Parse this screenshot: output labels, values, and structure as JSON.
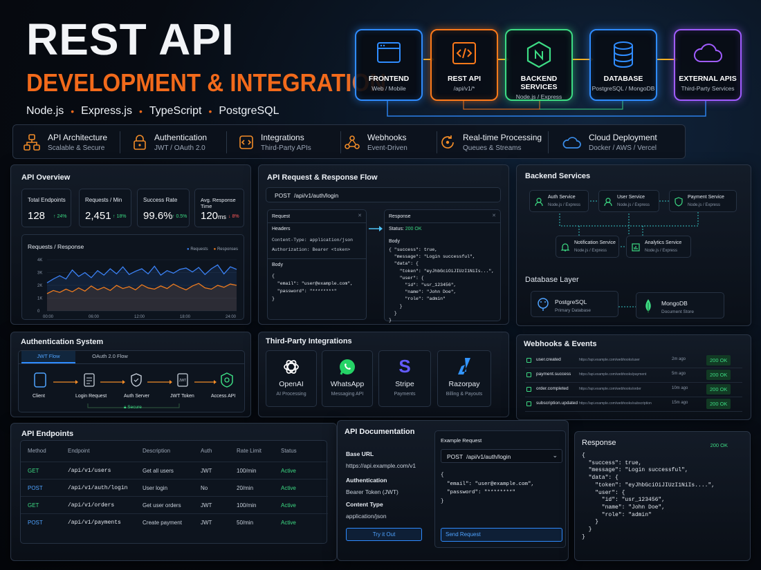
{
  "header": {
    "title_line1": "REST API",
    "title_line2": "DEVELOPMENT & INTEGRATION",
    "tech_stack": [
      "Node.js",
      "Express.js",
      "TypeScript",
      "PostgreSQL"
    ],
    "separator": "•"
  },
  "flow": [
    {
      "title": "FRONTEND",
      "sub": "Web / Mobile",
      "icon": "browser-window-icon",
      "color": "#2f8cff"
    },
    {
      "title": "REST API",
      "sub": "/api/v1/*",
      "icon": "code-icon",
      "color": "#ff7a1a"
    },
    {
      "title": "BACKEND SERVICES",
      "sub": "Node.js / Express",
      "icon": "nodejs-hexagon-icon",
      "color": "#3ddc84"
    },
    {
      "title": "DATABASE",
      "sub": "PostgreSQL / MongoDB",
      "icon": "database-icon",
      "color": "#2f8cff"
    },
    {
      "title": "EXTERNAL APIS",
      "sub": "Third-Party Services",
      "icon": "cloud-icon",
      "color": "#a05cff"
    }
  ],
  "features": [
    {
      "title": "API Architecture",
      "sub": "Scalable & Secure",
      "icon": "architecture-icon"
    },
    {
      "title": "Authentication",
      "sub": "JWT / OAuth 2.0",
      "icon": "lock-icon"
    },
    {
      "title": "Integrations",
      "sub": "Third-Party APIs",
      "icon": "integration-icon"
    },
    {
      "title": "Webhooks",
      "sub": "Event-Driven",
      "icon": "webhook-icon"
    },
    {
      "title": "Real-time Processing",
      "sub": "Queues & Streams",
      "icon": "refresh-icon"
    },
    {
      "title": "Cloud Deployment",
      "sub": "Docker / AWS / Vercel",
      "icon": "cloud-icon"
    }
  ],
  "overview": {
    "title": "API Overview",
    "stats": [
      {
        "label": "Total Endpoints",
        "value": "128",
        "delta": "↑ 24%",
        "up": true
      },
      {
        "label": "Requests / Min",
        "value": "2,451",
        "delta": "↑ 18%",
        "up": true
      },
      {
        "label": "Success Rate",
        "value": "99.6%",
        "delta": "↑ 0.5%",
        "up": true
      },
      {
        "label": "Avg. Response Time",
        "value": "120",
        "unit": "ms",
        "delta": "↓ 8%",
        "up": false
      }
    ],
    "chart_title": "Requests / Response"
  },
  "chart_data": {
    "type": "line",
    "title": "Requests / Response",
    "x": [
      "00:00",
      "06:00",
      "12:00",
      "18:00",
      "24:00"
    ],
    "yticks": [
      "4K",
      "3K",
      "2K",
      "1K",
      "0"
    ],
    "ylim": [
      0,
      4000
    ],
    "legend_position": "top-right",
    "series": [
      {
        "name": "Requests",
        "color": "#3b82f6",
        "values": [
          2200,
          2500,
          2750,
          2500,
          3200,
          2700,
          3000,
          2600,
          3150,
          2800,
          3300,
          2900,
          3450,
          2850,
          3100,
          3300,
          2900,
          3500,
          2800,
          3150,
          2950,
          3250,
          3350,
          3050,
          3400,
          2850,
          3300,
          3600,
          2900,
          3450,
          3250
        ]
      },
      {
        "name": "Responses",
        "color": "#f07c1e",
        "values": [
          1350,
          1600,
          1450,
          1700,
          1500,
          1800,
          1550,
          1950,
          1650,
          1850,
          1600,
          2000,
          1750,
          1900,
          1650,
          2050,
          1800,
          1700,
          1950,
          1750,
          2100,
          1850,
          1650,
          1950,
          2150,
          1800,
          1700,
          2000,
          1850,
          2100,
          2000
        ]
      }
    ]
  },
  "flowpanel": {
    "title": "API Request & Response Flow",
    "method": "POST",
    "path": "/api/v1/auth/login",
    "request_title": "Request",
    "headers_label": "Headers",
    "header_lines": [
      "Content-Type: application/json",
      "Authorization: Bearer <token>"
    ],
    "body_label": "Body",
    "body_code": "{\n  \"email\": \"user@example.com\",\n  \"password\": \"********\"\n}",
    "response_title": "Response",
    "status_label": "Status:",
    "status_value": "200 OK",
    "resp_body_label": "Body",
    "resp_code": "{ \"success\": true,\n  \"message\": \"Login successful\",\n  \"data\": {\n    \"token\": \"eyJhbGciOiJIUzI1NiIs...\",\n    \"user\": {\n      \"id\": \"usr_123456\",\n      \"name\": \"John Doe\",\n      \"role\": \"admin\"\n    }\n  }\n}"
  },
  "backend": {
    "title": "Backend Services",
    "services": [
      {
        "name": "Auth Service",
        "sub": "Node.js / Express",
        "icon": "user-icon"
      },
      {
        "name": "User Service",
        "sub": "Node.js / Express",
        "icon": "user-icon"
      },
      {
        "name": "Payment Service",
        "sub": "Node.js / Express",
        "icon": "shield-icon"
      },
      {
        "name": "Notification Service",
        "sub": "Node.js / Express",
        "icon": "bell-icon"
      },
      {
        "name": "Analytics Service",
        "sub": "Node.js / Express",
        "icon": "chart-icon"
      }
    ],
    "db_title": "Database Layer",
    "dbs": [
      {
        "name": "PostgreSQL",
        "sub": "Primary Database",
        "icon": "postgresql-icon"
      },
      {
        "name": "MongoDB",
        "sub": "Document Store",
        "icon": "mongodb-leaf-icon"
      }
    ]
  },
  "auth": {
    "title": "Authentication System",
    "tabs": [
      "JWT Flow",
      "OAuth 2.0 Flow"
    ],
    "steps": [
      "Client",
      "Login Request",
      "Auth Server",
      "JWT Token",
      "Access API"
    ],
    "secure_label": "Secure"
  },
  "integrations": {
    "title": "Third-Party Integrations",
    "items": [
      {
        "name": "OpenAI",
        "sub": "AI Processing",
        "icon": "openai-icon"
      },
      {
        "name": "WhatsApp",
        "sub": "Messaging API",
        "icon": "whatsapp-icon"
      },
      {
        "name": "Stripe",
        "sub": "Payments",
        "icon": "stripe-icon"
      },
      {
        "name": "Razorpay",
        "sub": "Billing & Payouts",
        "icon": "razorpay-icon"
      }
    ]
  },
  "webhooks": {
    "title": "Webhooks & Events",
    "rows": [
      {
        "event": "user.created",
        "url": "https://api.example.com/webhooks/user",
        "time": "2m ago",
        "status": "200 OK"
      },
      {
        "event": "payment.success",
        "url": "https://api.example.com/webhooks/payment",
        "time": "5m ago",
        "status": "200 OK"
      },
      {
        "event": "order.completed",
        "url": "https://api.example.com/webhooks/order",
        "time": "10m ago",
        "status": "200 OK"
      },
      {
        "event": "subscription.updated",
        "url": "https://api.example.com/webhooks/subscription",
        "time": "15m ago",
        "status": "200 OK"
      }
    ]
  },
  "endpoints": {
    "title": "API Endpoints",
    "columns": [
      "Method",
      "Endpoint",
      "Description",
      "Auth",
      "Rate Limit",
      "Status"
    ],
    "rows": [
      {
        "method": "GET",
        "endpoint": "/api/v1/users",
        "desc": "Get all users",
        "auth": "JWT",
        "limit": "100/min",
        "status": "Active"
      },
      {
        "method": "POST",
        "endpoint": "/api/v1/auth/login",
        "desc": "User login",
        "auth": "No",
        "limit": "20/min",
        "status": "Active"
      },
      {
        "method": "GET",
        "endpoint": "/api/v1/orders",
        "desc": "Get user orders",
        "auth": "JWT",
        "limit": "100/min",
        "status": "Active"
      },
      {
        "method": "POST",
        "endpoint": "/api/v1/payments",
        "desc": "Create payment",
        "auth": "JWT",
        "limit": "50/min",
        "status": "Active"
      }
    ]
  },
  "docs": {
    "title": "API Documentation",
    "base_url_label": "Base URL",
    "base_url": "https://api.example.com/v1",
    "auth_label": "Authentication",
    "auth_value": "Bearer Token (JWT)",
    "content_label": "Content Type",
    "content_value": "application/json",
    "try_button": "Try it Out",
    "example_label": "Example Request",
    "example_method": "POST",
    "example_path": "/api/v1/auth/login",
    "example_code": "{\n  \"email\": \"user@example.com\",\n  \"password\": \"********\"\n}",
    "send_button": "Send Request"
  },
  "response": {
    "title": "Response",
    "status": "200 OK",
    "code": "{\n  \"success\": true,\n  \"message\": \"Login successful\",\n  \"data\": {\n    \"token\": \"eyJhbGciOiJIUzI1NiIs....\",\n    \"user\": {\n      \"id\": \"usr_123456\",\n      \"name\": \"John Doe\",\n      \"role\": \"admin\"\n    }\n  }\n}"
  }
}
